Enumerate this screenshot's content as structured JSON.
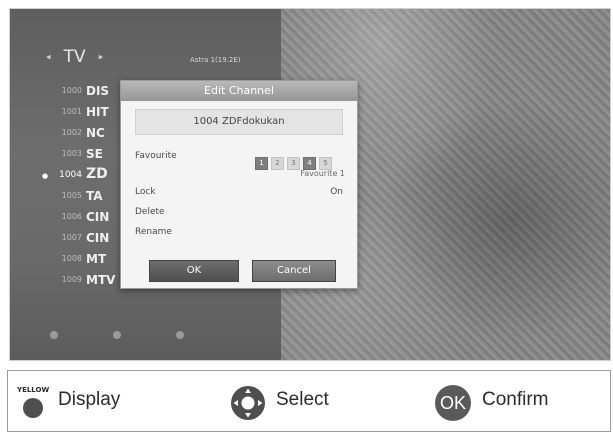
{
  "tv": {
    "header_title": "TV",
    "left_arrow": "◂",
    "right_arrow": "▸",
    "satellite": "Astra 1(19.2E)"
  },
  "channels": [
    {
      "num": "1000",
      "name": "DIS",
      "selected": false
    },
    {
      "num": "1001",
      "name": "HIT",
      "selected": false
    },
    {
      "num": "1002",
      "name": "NC",
      "selected": false
    },
    {
      "num": "1003",
      "name": "SE",
      "selected": false
    },
    {
      "num": "1004",
      "name": "ZD",
      "selected": true
    },
    {
      "num": "1005",
      "name": "TA",
      "selected": false
    },
    {
      "num": "1006",
      "name": "CIN",
      "selected": false
    },
    {
      "num": "1007",
      "name": "CIN",
      "selected": false
    },
    {
      "num": "1008",
      "name": "MT",
      "selected": false
    },
    {
      "num": "1009",
      "name": "MTV Deutschland",
      "selected": false
    }
  ],
  "dialog": {
    "title": "Edit Channel",
    "channel": "1004  ZDFdokukan",
    "favourite_label": "Favourite",
    "favourite_boxes": [
      {
        "n": "1",
        "on": true
      },
      {
        "n": "2",
        "on": false
      },
      {
        "n": "3",
        "on": false
      },
      {
        "n": "4",
        "on": true
      },
      {
        "n": "5",
        "on": false
      }
    ],
    "favourite_value": "Favourite 1",
    "lock_label": "Lock",
    "lock_value": "On",
    "delete_label": "Delete",
    "rename_label": "Rename",
    "ok_label": "OK",
    "cancel_label": "Cancel"
  },
  "legend": {
    "yellow_tag": "YELLOW",
    "display": "Display",
    "select": "Select",
    "ok_icon": "OK",
    "confirm": "Confirm"
  }
}
